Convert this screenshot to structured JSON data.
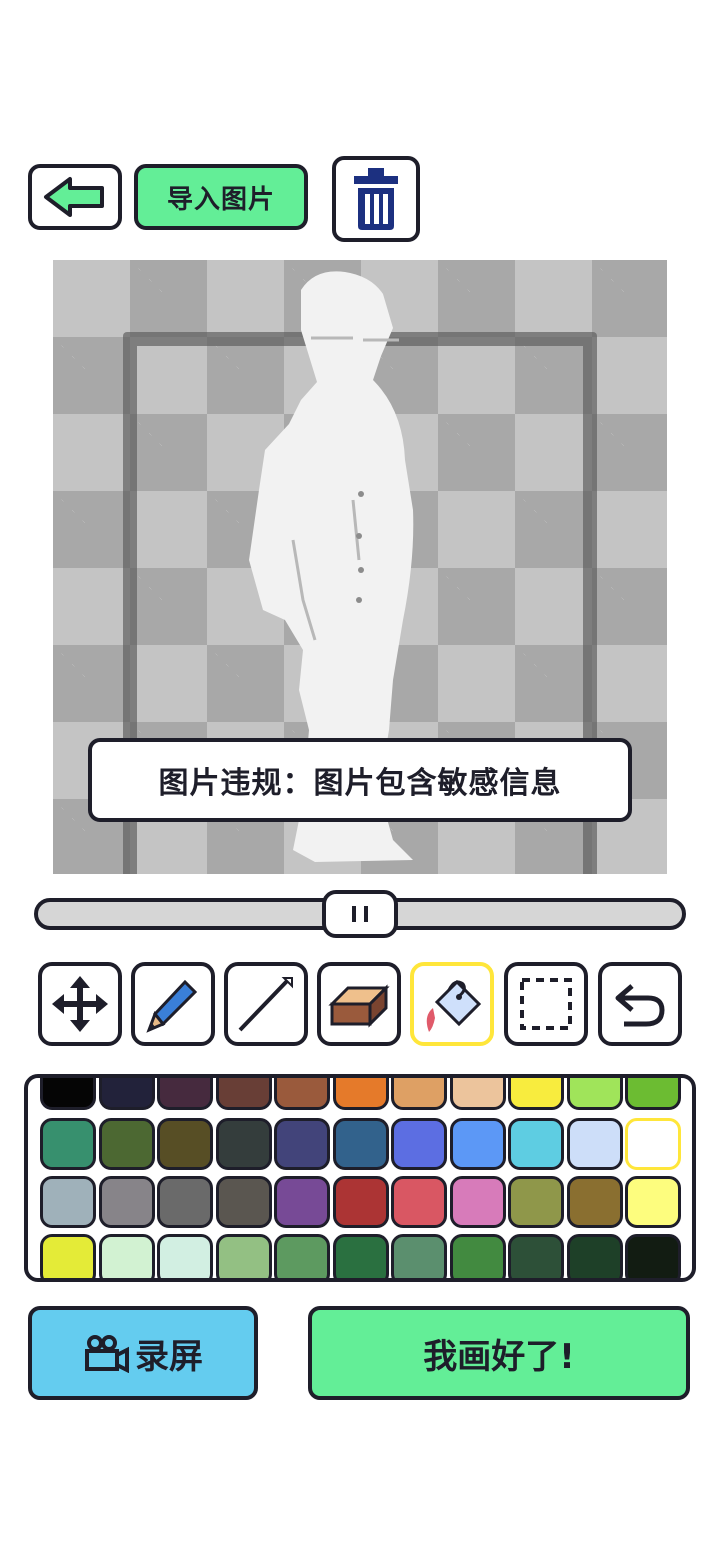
{
  "toolbar": {
    "back_icon": "arrow-left-icon",
    "import_label": "导入图片",
    "delete_icon": "trash-icon"
  },
  "canvas": {
    "alert_text": "图片违规：图片包含敏感信息"
  },
  "brush_slider": {
    "value_fraction": 0.5
  },
  "tools": [
    {
      "name": "move",
      "icon": "move-arrows-icon"
    },
    {
      "name": "pencil",
      "icon": "pencil-icon"
    },
    {
      "name": "line",
      "icon": "line-icon"
    },
    {
      "name": "eraser",
      "icon": "eraser-icon"
    },
    {
      "name": "fill",
      "icon": "paint-bucket-icon",
      "active": true
    },
    {
      "name": "select",
      "icon": "marquee-select-icon"
    },
    {
      "name": "undo",
      "icon": "undo-icon"
    }
  ],
  "palette": {
    "rows": [
      [
        "#050505",
        "#22223a",
        "#462a3e",
        "#683e36",
        "#9a5a3c",
        "#e57a2a",
        "#dea064",
        "#ecc49c",
        "#f8ec3e",
        "#a0e45a",
        "#6cbc32"
      ],
      [
        "#37906e",
        "#4c6832",
        "#574e25",
        "#343d3c",
        "#42447a",
        "#32628c",
        "#5c6ee2",
        "#5c98f6",
        "#5ecde2",
        "#cddef9",
        "#ffffff"
      ],
      [
        "#9fb1ba",
        "#878489",
        "#6a6a6a",
        "#5a5650",
        "#774a96",
        "#ac3434",
        "#d95763",
        "#d77bba",
        "#8f974a",
        "#8a6f30",
        "#fdfd7e"
      ],
      [
        "#e4eb37",
        "#d2f2d2",
        "#d2efe2",
        "#93c083",
        "#5d9a60",
        "#2a7040",
        "#5b8f6e",
        "#428a40",
        "#2d5038",
        "#1e4028",
        "#121c12"
      ]
    ],
    "selected": "#ffffff"
  },
  "actions": {
    "record_label": "录屏",
    "record_icon": "video-camera-icon",
    "done_label": "我画好了!"
  },
  "colors": {
    "green_button": "#63ee97",
    "blue_button": "#64ccef",
    "outline": "#1e1e2a",
    "active_tool": "#ffe63a"
  }
}
